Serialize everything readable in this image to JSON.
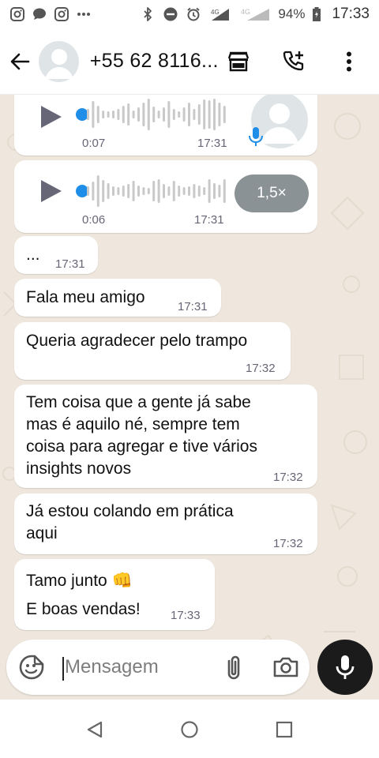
{
  "status_bar": {
    "time": "17:33",
    "battery_percent": "94%",
    "network": "4G",
    "network_2": "4G",
    "icons": [
      "instagram-icon",
      "chat-bubble-icon",
      "instagram-icon",
      "more-dots-icon",
      "bluetooth-icon",
      "do-not-disturb-icon",
      "alarm-icon",
      "signal-icon",
      "signal-icon",
      "battery-icon"
    ]
  },
  "header": {
    "contact_name": "+55 62 8116...",
    "icons": [
      "back-arrow-icon",
      "avatar",
      "shop-icon",
      "add-call-icon",
      "more-vertical-icon"
    ]
  },
  "colors": {
    "chat_bg": "#efe7dd",
    "bubble": "#ffffff",
    "audio_dot": "#1f8ee8",
    "mic_badge": "#1f8ee8",
    "speed_chip": "#8a9296",
    "mic_button": "#1b1b1b"
  },
  "messages": {
    "audio_1": {
      "duration": "0:07",
      "time": "17:31"
    },
    "audio_2": {
      "duration": "0:06",
      "time": "17:31",
      "speed": "1,5×"
    },
    "m1": {
      "text": "...",
      "time": "17:31"
    },
    "m2": {
      "text": "Fala meu amigo",
      "time": "17:31"
    },
    "m3": {
      "text": "Queria agradecer pelo trampo",
      "time": "17:32"
    },
    "m4": {
      "lines": [
        "Tem coisa que a gente já sabe",
        "mas é aquilo né, sempre tem",
        "coisa para agregar e tive vários",
        "insights novos"
      ],
      "time": "17:32"
    },
    "m5": {
      "lines": [
        "Já estou colando em prática",
        "aqui"
      ],
      "time": "17:32"
    },
    "m6": {
      "lines": [
        "Tamo junto 👊",
        "E boas vendas!"
      ],
      "time": "17:33"
    }
  },
  "composer": {
    "placeholder": "Mensagem",
    "icons": [
      "emoji-icon",
      "attach-icon",
      "camera-icon",
      "mic-icon"
    ]
  },
  "nav_bar": {
    "icons": [
      "back-triangle-icon",
      "home-circle-icon",
      "recents-square-icon"
    ]
  }
}
